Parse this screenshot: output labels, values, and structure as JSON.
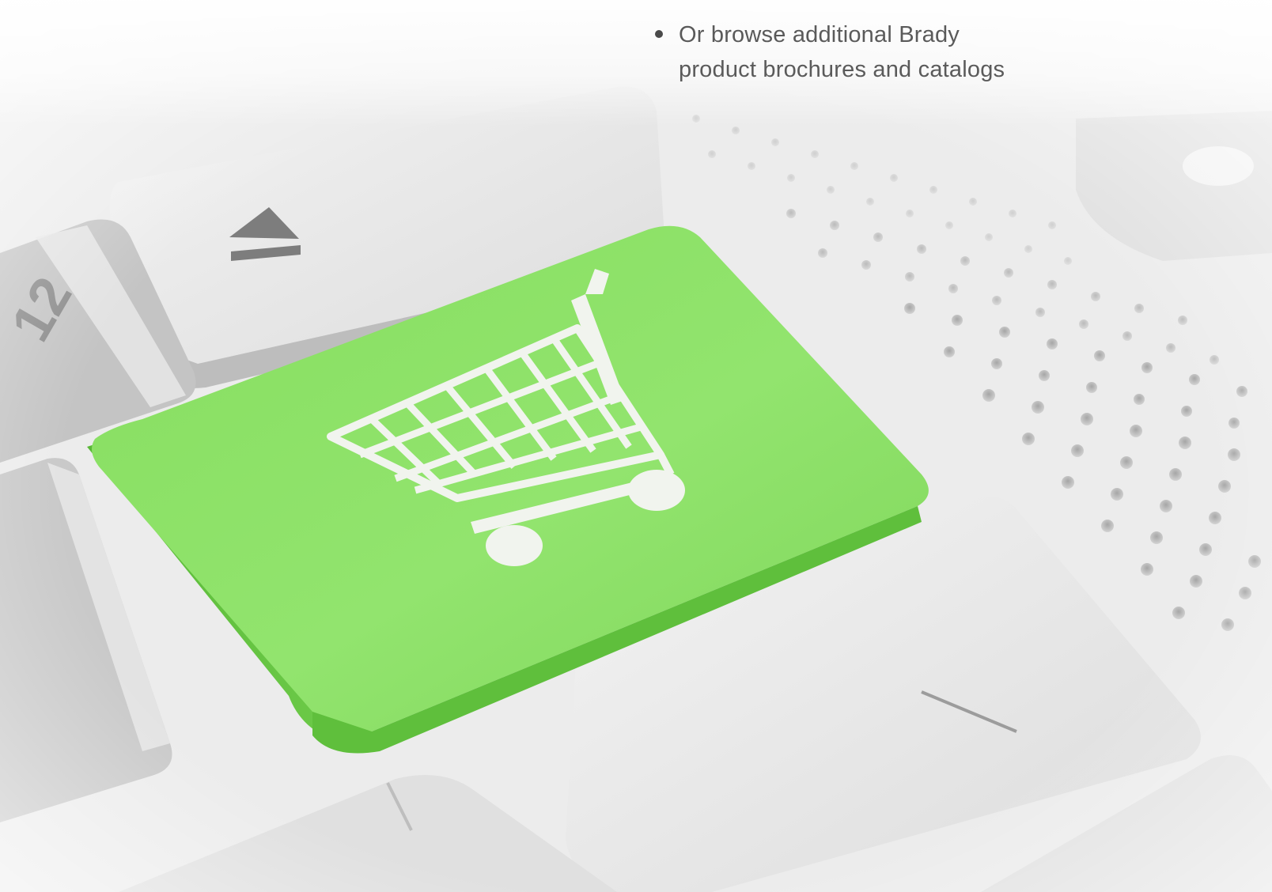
{
  "bullet": {
    "line1": "Or browse additional Brady",
    "line2": "product brochures and catalogs"
  },
  "colors": {
    "key_green": "#7fdc5c",
    "key_green_dark": "#62c43f",
    "key_grey": "#d8d8d8",
    "text": "#5a5a5a"
  },
  "icons": {
    "main_key": "shopping-cart-icon",
    "eject_key": "eject-icon"
  },
  "key_labels": {
    "f12": "12"
  }
}
